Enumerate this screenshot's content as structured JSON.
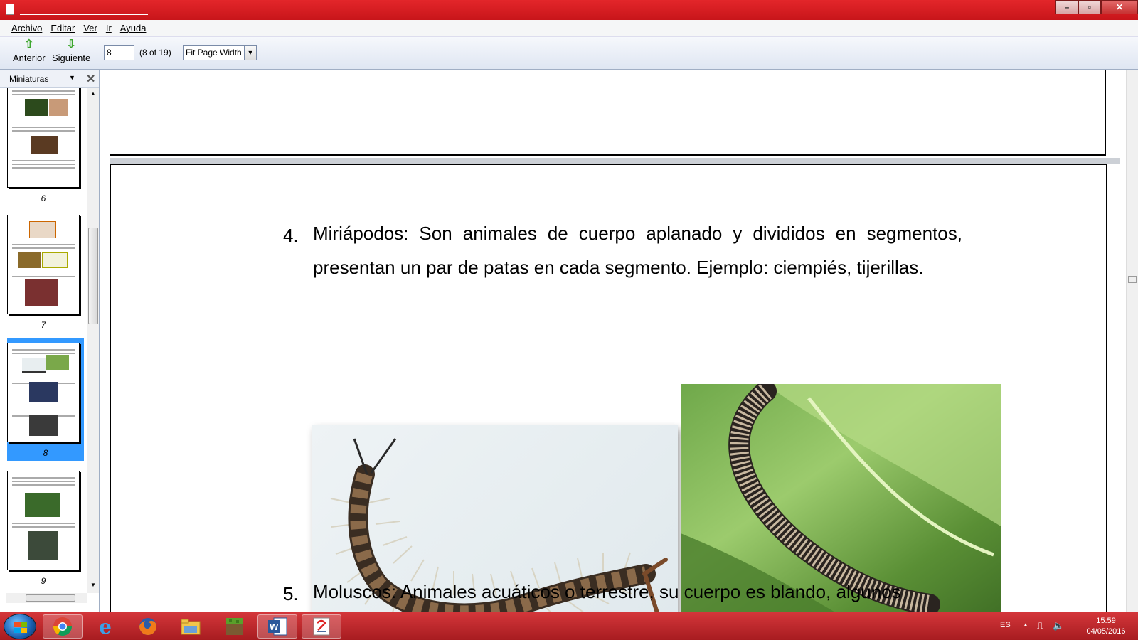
{
  "window": {
    "title": "",
    "controls": [
      "minimize",
      "maximize",
      "close"
    ]
  },
  "menu": [
    "Archivo",
    "Editar",
    "Ver",
    "Ir",
    "Ayuda"
  ],
  "toolbar": {
    "prev_label": "Anterior",
    "next_label": "Siguiente",
    "page_value": "8",
    "page_count": "(8 of 19)",
    "zoom_value": "Fit Page Width"
  },
  "sidebar": {
    "title": "Miniaturas",
    "thumbnails": [
      {
        "page": "6",
        "selected": false
      },
      {
        "page": "7",
        "selected": false
      },
      {
        "page": "8",
        "selected": true
      },
      {
        "page": "9",
        "selected": false
      }
    ]
  },
  "document": {
    "items": [
      {
        "num": "4.",
        "text": "Miriápodos: Son animales de cuerpo aplanado y divididos en segmentos, presentan un par de patas en cada segmento. Ejemplo: ciempiés, tijerillas."
      },
      {
        "num": "5.",
        "text": "Moluscos: Animales acuáticos o terrestre, su cuerpo es blando, algunos"
      }
    ],
    "images": [
      "centipede photo",
      "millipede on leaf photo"
    ]
  },
  "taskbar": {
    "apps": [
      "chrome",
      "internet-explorer",
      "firefox",
      "file-explorer",
      "minecraft",
      "word",
      "pdf-reader"
    ],
    "active_app": "pdf-reader",
    "language": "ES",
    "time": "15:59",
    "date": "04/05/2016"
  },
  "colors": {
    "title_bar": "#d3202a",
    "selection": "#3399ff",
    "taskbar": "#c1272b"
  }
}
